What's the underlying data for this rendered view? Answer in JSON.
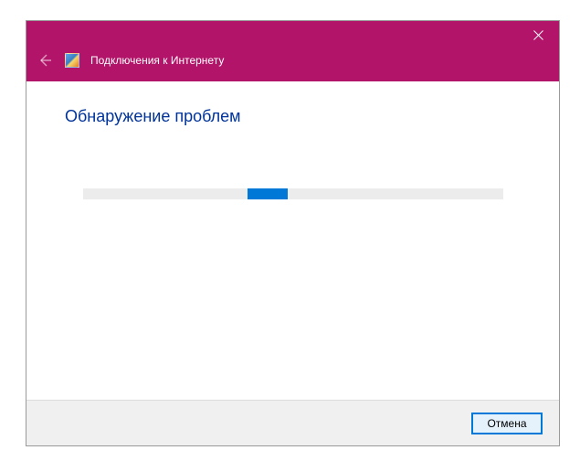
{
  "titlebar": {
    "close_icon": "close"
  },
  "header": {
    "back_icon": "back-arrow",
    "wizard_icon": "troubleshooter",
    "title": "Подключения к Интернету"
  },
  "content": {
    "heading": "Обнаружение проблем",
    "progress": {
      "indeterminate": true,
      "chunk_position_percent": 39
    }
  },
  "footer": {
    "cancel_label": "Отмена"
  },
  "colors": {
    "accent": "#b11468",
    "heading": "#003399",
    "progress_bar": "#0078d7"
  }
}
